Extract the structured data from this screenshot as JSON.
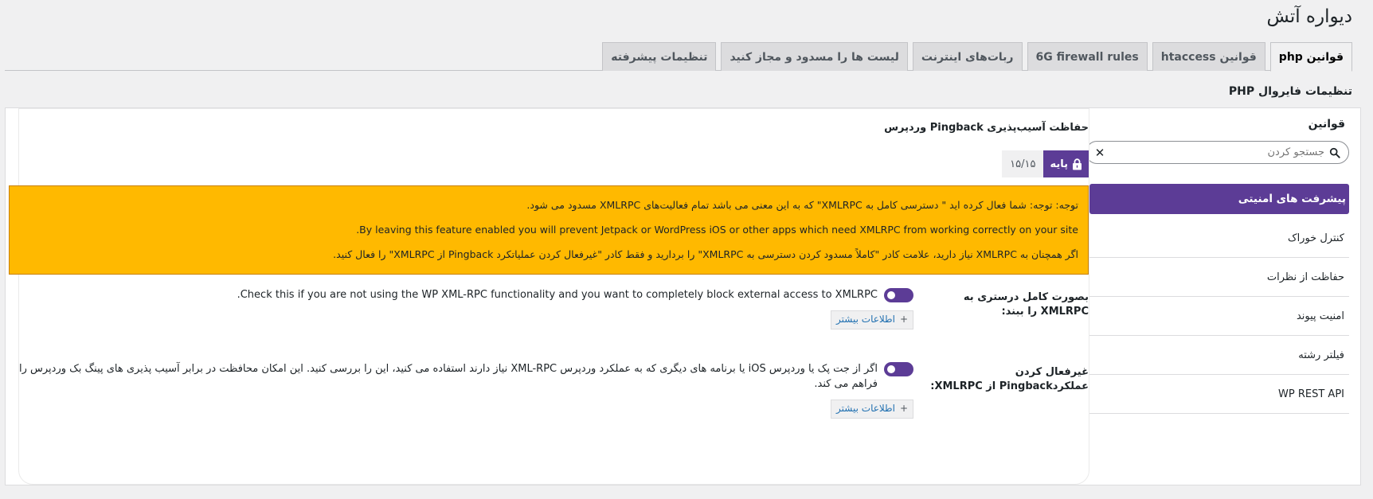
{
  "page": {
    "title": "دیواره آتش"
  },
  "tabs": [
    {
      "label": "قوانین php",
      "active": true
    },
    {
      "label": "قوانین htaccess",
      "active": false
    },
    {
      "label": "6G firewall rules",
      "active": false
    },
    {
      "label": "ربات‌های اینترنت",
      "active": false
    },
    {
      "label": "لیست ها را مسدود و مجاز کنید",
      "active": false
    },
    {
      "label": "تنظیمات پیشرفته",
      "active": false
    }
  ],
  "section": {
    "title": "تنظیمات فایروال PHP"
  },
  "sidebar": {
    "title": "قوانین",
    "search_placeholder": "جستجو کردن",
    "items": [
      {
        "label": "پیشرفت های امنیتی",
        "active": true
      },
      {
        "label": "کنترل خوراک"
      },
      {
        "label": "حفاظت از نظرات"
      },
      {
        "label": "امنیت پیوند"
      },
      {
        "label": "فیلتر رشته"
      },
      {
        "label": "WP REST API"
      }
    ]
  },
  "content": {
    "title": "حفاظت آسیب‌پذیری Pingback وردپرس",
    "level_label": "پایه",
    "level_count": "۱۵/۱۵",
    "notice": {
      "line1": "توجه: توجه: شما فعال کرده اید \" دسترسی کامل به XMLRPC\" که به این معنی می باشد تمام فعالیت‌های XMLRPC مسدود می شود.",
      "line2": "By leaving this feature enabled you will prevent Jetpack or WordPress iOS or other apps which need XMLRPC from working correctly on your site.",
      "line3": "اگر همچنان به XMLRPC نیاز دارید، علامت کادر \"کاملاً مسدود کردن دسترسی به XMLRPC\" را بردارید و فقط کادر \"غیرفعال کردن عملیاتکرد Pingback از XMLRPC\" را فعال کنید."
    },
    "settings": [
      {
        "label": "بصورت کامل درستری به XMLRPC را ببند:",
        "description": "Check this if you are not using the WP XML-RPC functionality and you want to completely block external access to XMLRPC.",
        "enabled": true,
        "more_label": "اطلاعات بیشتر"
      },
      {
        "label": "غیرفعال کردن عملکردPingback از XMLRPC:",
        "description": "اگر از جت پک یا وردپرس iOS یا برنامه های دیگری که به عملکرد وردپرس XML-RPC نیاز دارند استفاده می کنید، این را بررسی کنید. این امکان محافظت در برابر آسیب پذیری های پینگ بک وردپرس را فراهم می کند.",
        "enabled": true,
        "more_label": "اطلاعات بیشتر"
      }
    ]
  },
  "colors": {
    "accent": "#5c3c96",
    "notice_bg": "#ffb900",
    "link": "#2271b1"
  },
  "icons": {
    "search": "search-icon",
    "clear": "close-icon",
    "lock": "lock-icon"
  }
}
